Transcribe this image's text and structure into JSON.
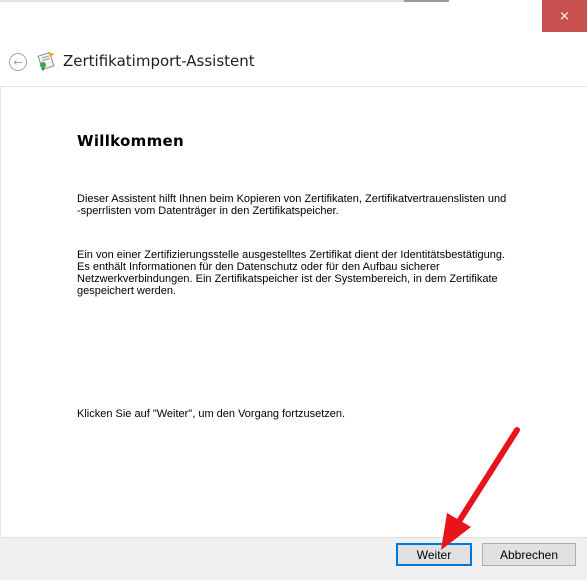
{
  "window": {
    "close_symbol": "×"
  },
  "header": {
    "back_symbol": "←",
    "title": "Zertifikatimport-Assistent",
    "icon": "certificate-wizard-icon"
  },
  "content": {
    "heading": "Willkommen",
    "paragraph_1": "Dieser Assistent hilft Ihnen beim Kopieren von Zertifikaten, Zertifikatvertrauenslisten und\n-sperrlisten vom Datenträger in den Zertifikatspeicher.",
    "paragraph_2": "Ein von einer Zertifizierungsstelle ausgestelltes Zertifikat dient der Identitätsbestätigung.\nEs enthält Informationen für den Datenschutz oder für den Aufbau sicherer\nNetzwerkverbindungen. Ein Zertifikatspeicher ist der Systembereich, in dem Zertifikate\ngespeichert werden.",
    "paragraph_3": "Klicken Sie auf \"Weiter\", um den Vorgang fortzusetzen."
  },
  "footer": {
    "next_label": "Weiter",
    "cancel_label": "Abbrechen"
  },
  "colors": {
    "close_button": "#c75050",
    "annotation_arrow": "#e8141b",
    "default_button_border": "#0078d7"
  }
}
